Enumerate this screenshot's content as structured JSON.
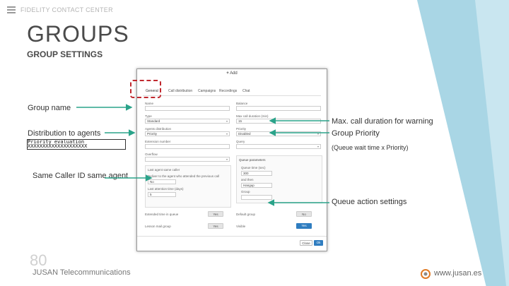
{
  "header": {
    "brand": "FIDELITY CONTACT CENTER",
    "title": "GROUPS",
    "subtitle": "GROUP SETTINGS"
  },
  "annotations": {
    "group_name": "Group name",
    "distribution": "Distribution to agents",
    "highlight_line1": "Priority evaluation",
    "highlight_line2": "XXXXXXXXXXXXXXXXXXXX",
    "same_caller": "Same Caller ID same agent",
    "max_call": "Max. call duration for warning",
    "group_priority": "Group Priority",
    "priority_formula": "(Queue wait time x Priority)",
    "queue_action": "Queue action settings"
  },
  "dialog": {
    "add_icon": "+",
    "title": "Add",
    "tabs": [
      "General",
      "Call distribution",
      "Campaigns",
      "Recordings",
      "Chat"
    ],
    "fields": {
      "name_label": "Name",
      "type_label": "Type",
      "type_value": "Standard",
      "distribution_label": "Agents distribution",
      "distribution_value": "Priority",
      "number_label": "Extension number",
      "overflow_label": "Overflow",
      "balance_label": "Balance",
      "max_call_label": "Max call duration (min)",
      "max_call_value": "15",
      "priority_label": "Priority",
      "priority_value": "Disabled",
      "query_label": "Query",
      "queue_params": "Queue parameters",
      "queue_time": "Queue time (sec)",
      "queue_time_value": "300",
      "and_then": "and then",
      "and_then_value": "Hangup",
      "group_label": "Group",
      "last_agent": "Last agent same caller",
      "last_agent_note": "Deliver to the agent who attended the previous call",
      "last_agent_value": "No",
      "last_agent_time": "Last attention time (days)",
      "last_agent_time_value": "5",
      "extended_time": "Extended time in queue",
      "extended_value": "Yes",
      "lesson": "Lesson mail group",
      "lesson_value": "Yes",
      "default_group": "Default group",
      "default_value": "No",
      "visible": "Visible",
      "visible_value": "Yes"
    },
    "close_btn": "Close",
    "ok_btn": "Ok"
  },
  "footer": {
    "page_number": "80",
    "company": "JUSAN Telecommunications",
    "website": "www.jusan.es"
  },
  "colors": {
    "arrow": "#2aa38a",
    "highlight": "#c0282e",
    "deco": "#a9d6e5",
    "primary_btn": "#2f7dc0"
  }
}
